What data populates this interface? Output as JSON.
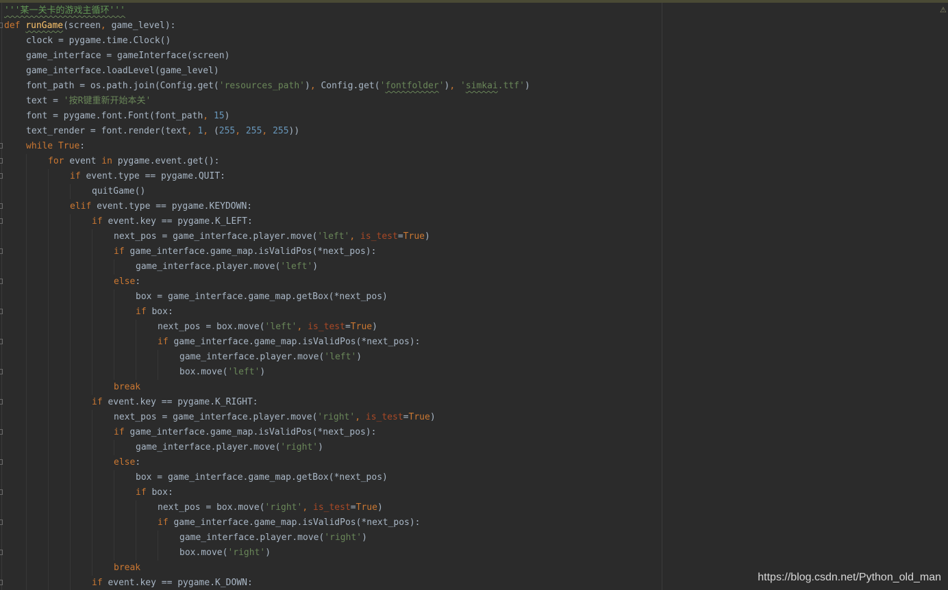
{
  "editor": {
    "language": "python",
    "warning_icon": "warning-triangle-icon",
    "colors": {
      "background": "#2b2b2b",
      "default_text": "#a9b7c6",
      "keyword": "#cc7832",
      "string": "#6a8759",
      "number": "#6897bb",
      "function_name": "#ffc66d",
      "named_parameter": "#aa4926",
      "docstring": "#629755"
    },
    "lines": [
      {
        "indent": 0,
        "fold": false,
        "tokens": [
          {
            "t": "'''某一关卡的游戏主循环'''",
            "c": "doc",
            "wavy": true
          }
        ]
      },
      {
        "indent": 0,
        "fold": true,
        "tokens": [
          {
            "t": "def ",
            "c": "kw"
          },
          {
            "t": "runGame",
            "c": "fn"
          },
          {
            "t": "(screen",
            "c": "plain"
          },
          {
            "t": ", ",
            "c": "kw"
          },
          {
            "t": "game_level):",
            "c": "plain"
          }
        ]
      },
      {
        "indent": 1,
        "fold": false,
        "tokens": [
          {
            "t": "clock = pygame.time.Clock()",
            "c": "plain"
          }
        ]
      },
      {
        "indent": 1,
        "fold": false,
        "tokens": [
          {
            "t": "game_interface = gameInterface(screen)",
            "c": "plain"
          }
        ]
      },
      {
        "indent": 1,
        "fold": false,
        "tokens": [
          {
            "t": "game_interface.loadLevel(game_level)",
            "c": "plain"
          }
        ]
      },
      {
        "indent": 1,
        "fold": false,
        "tokens": [
          {
            "t": "font_path = os.path.join(Config.get(",
            "c": "plain"
          },
          {
            "t": "'resources_path'",
            "c": "str"
          },
          {
            "t": ")",
            "c": "plain"
          },
          {
            "t": ", ",
            "c": "kw"
          },
          {
            "t": "Config.get(",
            "c": "plain"
          },
          {
            "t": "'",
            "c": "str"
          },
          {
            "t": "fontfolder",
            "c": "str",
            "wavy": true
          },
          {
            "t": "'",
            "c": "str"
          },
          {
            "t": ")",
            "c": "plain"
          },
          {
            "t": ", ",
            "c": "kw"
          },
          {
            "t": "'",
            "c": "str"
          },
          {
            "t": "simkai",
            "c": "str",
            "wavy": true
          },
          {
            "t": ".ttf'",
            "c": "str"
          },
          {
            "t": ")",
            "c": "plain"
          }
        ]
      },
      {
        "indent": 1,
        "fold": false,
        "tokens": [
          {
            "t": "text = ",
            "c": "plain"
          },
          {
            "t": "'按R键重新开始本关'",
            "c": "str"
          }
        ]
      },
      {
        "indent": 1,
        "fold": false,
        "tokens": [
          {
            "t": "font = pygame.font.Font(font_path",
            "c": "plain"
          },
          {
            "t": ", ",
            "c": "kw"
          },
          {
            "t": "15",
            "c": "num"
          },
          {
            "t": ")",
            "c": "plain"
          }
        ]
      },
      {
        "indent": 1,
        "fold": false,
        "tokens": [
          {
            "t": "text_render = font.render(text",
            "c": "plain"
          },
          {
            "t": ", ",
            "c": "kw"
          },
          {
            "t": "1",
            "c": "num"
          },
          {
            "t": ", ",
            "c": "kw"
          },
          {
            "t": "(",
            "c": "plain"
          },
          {
            "t": "255",
            "c": "num"
          },
          {
            "t": ", ",
            "c": "kw"
          },
          {
            "t": "255",
            "c": "num"
          },
          {
            "t": ", ",
            "c": "kw"
          },
          {
            "t": "255",
            "c": "num"
          },
          {
            "t": "))",
            "c": "plain"
          }
        ]
      },
      {
        "indent": 1,
        "fold": true,
        "tokens": [
          {
            "t": "while ",
            "c": "kw"
          },
          {
            "t": "True",
            "c": "kw"
          },
          {
            "t": ":",
            "c": "plain"
          }
        ]
      },
      {
        "indent": 2,
        "fold": true,
        "tokens": [
          {
            "t": "for ",
            "c": "kw"
          },
          {
            "t": "event ",
            "c": "plain"
          },
          {
            "t": "in ",
            "c": "kw"
          },
          {
            "t": "pygame.event.get():",
            "c": "plain"
          }
        ]
      },
      {
        "indent": 3,
        "fold": true,
        "tokens": [
          {
            "t": "if ",
            "c": "kw"
          },
          {
            "t": "event.type == pygame.QUIT:",
            "c": "plain"
          }
        ]
      },
      {
        "indent": 4,
        "fold": false,
        "tokens": [
          {
            "t": "quitGame()",
            "c": "plain"
          }
        ]
      },
      {
        "indent": 3,
        "fold": true,
        "tokens": [
          {
            "t": "elif ",
            "c": "kw"
          },
          {
            "t": "event.type == pygame.KEYDOWN:",
            "c": "plain"
          }
        ]
      },
      {
        "indent": 4,
        "fold": true,
        "tokens": [
          {
            "t": "if ",
            "c": "kw"
          },
          {
            "t": "event.key == pygame.K_LEFT:",
            "c": "plain"
          }
        ]
      },
      {
        "indent": 5,
        "fold": false,
        "tokens": [
          {
            "t": "next_pos = game_interface.player.move(",
            "c": "plain"
          },
          {
            "t": "'left'",
            "c": "str"
          },
          {
            "t": ", ",
            "c": "kw"
          },
          {
            "t": "is_test",
            "c": "param"
          },
          {
            "t": "=",
            "c": "plain"
          },
          {
            "t": "True",
            "c": "kw"
          },
          {
            "t": ")",
            "c": "plain"
          }
        ]
      },
      {
        "indent": 5,
        "fold": true,
        "tokens": [
          {
            "t": "if ",
            "c": "kw"
          },
          {
            "t": "game_interface.game_map.isValidPos(*next_pos):",
            "c": "plain"
          }
        ]
      },
      {
        "indent": 6,
        "fold": false,
        "tokens": [
          {
            "t": "game_interface.player.move(",
            "c": "plain"
          },
          {
            "t": "'left'",
            "c": "str"
          },
          {
            "t": ")",
            "c": "plain"
          }
        ]
      },
      {
        "indent": 5,
        "fold": true,
        "tokens": [
          {
            "t": "else",
            "c": "kw"
          },
          {
            "t": ":",
            "c": "plain"
          }
        ]
      },
      {
        "indent": 6,
        "fold": false,
        "tokens": [
          {
            "t": "box = game_interface.game_map.getBox(*next_pos)",
            "c": "plain"
          }
        ]
      },
      {
        "indent": 6,
        "fold": true,
        "tokens": [
          {
            "t": "if ",
            "c": "kw"
          },
          {
            "t": "box:",
            "c": "plain"
          }
        ]
      },
      {
        "indent": 7,
        "fold": false,
        "tokens": [
          {
            "t": "next_pos = box.move(",
            "c": "plain"
          },
          {
            "t": "'left'",
            "c": "str"
          },
          {
            "t": ", ",
            "c": "kw"
          },
          {
            "t": "is_test",
            "c": "param"
          },
          {
            "t": "=",
            "c": "plain"
          },
          {
            "t": "True",
            "c": "kw"
          },
          {
            "t": ")",
            "c": "plain"
          }
        ]
      },
      {
        "indent": 7,
        "fold": true,
        "tokens": [
          {
            "t": "if ",
            "c": "kw"
          },
          {
            "t": "game_interface.game_map.isValidPos(*next_pos):",
            "c": "plain"
          }
        ]
      },
      {
        "indent": 8,
        "fold": false,
        "tokens": [
          {
            "t": "game_interface.player.move(",
            "c": "plain"
          },
          {
            "t": "'left'",
            "c": "str"
          },
          {
            "t": ")",
            "c": "plain"
          }
        ]
      },
      {
        "indent": 8,
        "fold": true,
        "tokens": [
          {
            "t": "box.move(",
            "c": "plain"
          },
          {
            "t": "'left'",
            "c": "str"
          },
          {
            "t": ")",
            "c": "plain"
          }
        ]
      },
      {
        "indent": 5,
        "fold": false,
        "tokens": [
          {
            "t": "break",
            "c": "kw"
          }
        ]
      },
      {
        "indent": 4,
        "fold": true,
        "tokens": [
          {
            "t": "if ",
            "c": "kw"
          },
          {
            "t": "event.key == pygame.K_RIGHT:",
            "c": "plain"
          }
        ]
      },
      {
        "indent": 5,
        "fold": false,
        "tokens": [
          {
            "t": "next_pos = game_interface.player.move(",
            "c": "plain"
          },
          {
            "t": "'right'",
            "c": "str"
          },
          {
            "t": ", ",
            "c": "kw"
          },
          {
            "t": "is_test",
            "c": "param"
          },
          {
            "t": "=",
            "c": "plain"
          },
          {
            "t": "True",
            "c": "kw"
          },
          {
            "t": ")",
            "c": "plain"
          }
        ]
      },
      {
        "indent": 5,
        "fold": true,
        "tokens": [
          {
            "t": "if ",
            "c": "kw"
          },
          {
            "t": "game_interface.game_map.isValidPos(*next_pos):",
            "c": "plain"
          }
        ]
      },
      {
        "indent": 6,
        "fold": false,
        "tokens": [
          {
            "t": "game_interface.player.move(",
            "c": "plain"
          },
          {
            "t": "'right'",
            "c": "str"
          },
          {
            "t": ")",
            "c": "plain"
          }
        ]
      },
      {
        "indent": 5,
        "fold": true,
        "tokens": [
          {
            "t": "else",
            "c": "kw"
          },
          {
            "t": ":",
            "c": "plain"
          }
        ]
      },
      {
        "indent": 6,
        "fold": false,
        "tokens": [
          {
            "t": "box = game_interface.game_map.getBox(*next_pos)",
            "c": "plain"
          }
        ]
      },
      {
        "indent": 6,
        "fold": true,
        "tokens": [
          {
            "t": "if ",
            "c": "kw"
          },
          {
            "t": "box:",
            "c": "plain"
          }
        ]
      },
      {
        "indent": 7,
        "fold": false,
        "tokens": [
          {
            "t": "next_pos = box.move(",
            "c": "plain"
          },
          {
            "t": "'right'",
            "c": "str"
          },
          {
            "t": ", ",
            "c": "kw"
          },
          {
            "t": "is_test",
            "c": "param"
          },
          {
            "t": "=",
            "c": "plain"
          },
          {
            "t": "True",
            "c": "kw"
          },
          {
            "t": ")",
            "c": "plain"
          }
        ]
      },
      {
        "indent": 7,
        "fold": true,
        "tokens": [
          {
            "t": "if ",
            "c": "kw"
          },
          {
            "t": "game_interface.game_map.isValidPos(*next_pos):",
            "c": "plain"
          }
        ]
      },
      {
        "indent": 8,
        "fold": false,
        "tokens": [
          {
            "t": "game_interface.player.move(",
            "c": "plain"
          },
          {
            "t": "'right'",
            "c": "str"
          },
          {
            "t": ")",
            "c": "plain"
          }
        ]
      },
      {
        "indent": 8,
        "fold": true,
        "tokens": [
          {
            "t": "box.move(",
            "c": "plain"
          },
          {
            "t": "'right'",
            "c": "str"
          },
          {
            "t": ")",
            "c": "plain"
          }
        ]
      },
      {
        "indent": 5,
        "fold": false,
        "tokens": [
          {
            "t": "break",
            "c": "kw"
          }
        ]
      },
      {
        "indent": 4,
        "fold": true,
        "tokens": [
          {
            "t": "if ",
            "c": "kw"
          },
          {
            "t": "event.key == pygame.K_DOWN:",
            "c": "plain"
          }
        ]
      }
    ]
  },
  "watermark": {
    "text": "https://blog.csdn.net/Python_old_man"
  }
}
